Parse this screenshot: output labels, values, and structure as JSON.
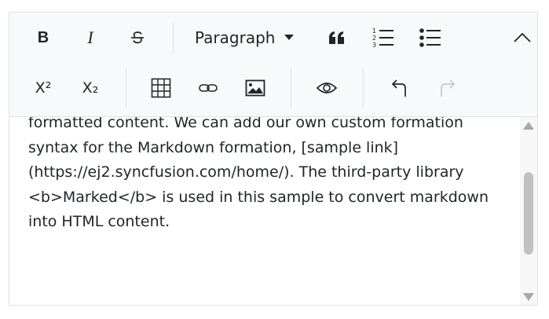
{
  "toolbar": {
    "bold": "B",
    "italic": "I",
    "format_select": "Paragraph",
    "superscript": "X²",
    "subscript": "X₂"
  },
  "content": {
    "paragraph": "formatted content. We can add our own custom formation syntax for the Markdown formation, [sample link] (https://ej2.syncfusion.com/home/). The third-party library <b>Marked</b> is used in this sample to convert markdown into HTML content."
  },
  "colors": {
    "toolbar_bg": "#f8f9fa",
    "text": "#212529",
    "border": "#dee2e6",
    "disabled": "#c6c8ca"
  },
  "icons": [
    "bold-icon",
    "italic-icon",
    "strikethrough-icon",
    "chevron-down-icon",
    "blockquote-icon",
    "ordered-list-icon",
    "unordered-list-icon",
    "collapse-icon",
    "table-icon",
    "link-icon",
    "image-icon",
    "preview-icon",
    "undo-icon",
    "redo-icon"
  ]
}
